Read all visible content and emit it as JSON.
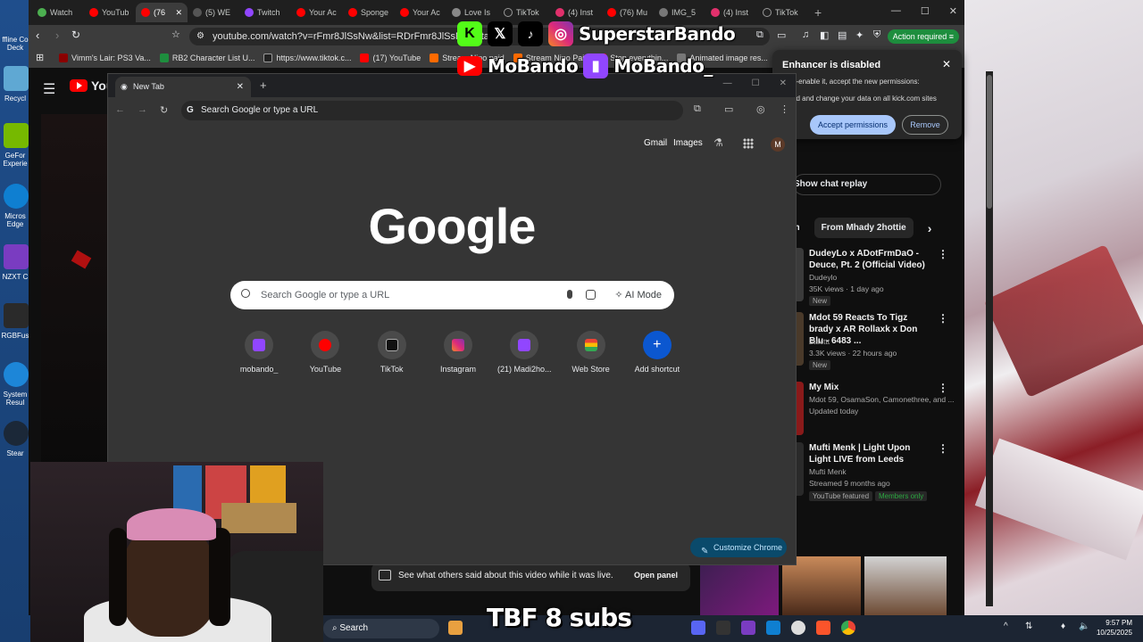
{
  "browser": {
    "tabs": [
      {
        "label": "Watch",
        "color": "#4caf50"
      },
      {
        "label": "YouTub",
        "color": "#ff0000"
      },
      {
        "label": "(76",
        "color": "#ff0000",
        "active": true
      },
      {
        "label": "(5) WE",
        "color": "#555555"
      },
      {
        "label": "Twitch",
        "color": "#9146ff"
      },
      {
        "label": "Your Ac",
        "color": "#ff0000"
      },
      {
        "label": "Sponge",
        "color": "#ff0000"
      },
      {
        "label": "Your Ac",
        "color": "#ff0000"
      },
      {
        "label": "Love Is",
        "color": "#888888"
      },
      {
        "label": "TikTok",
        "color": "#222222"
      },
      {
        "label": "(4) Inst",
        "color": "#e1306c"
      },
      {
        "label": "(76) Mu",
        "color": "#ff0000"
      },
      {
        "label": "IMG_5",
        "color": "#777777"
      },
      {
        "label": "(4) Inst",
        "color": "#e1306c"
      },
      {
        "label": "TikTok",
        "color": "#222222"
      }
    ],
    "url": "youtube.com/watch?v=rFmr8JlSsNw&list=RDrFmr8JlSsNw&start_",
    "action_required": "Action required",
    "bookmarks": [
      {
        "label": "Vimm's Lair: PS3 Va...",
        "color": "#8b0000"
      },
      {
        "label": "RB2 Character List U...",
        "color": "#1e8e3e"
      },
      {
        "label": "https://www.tiktok.c...",
        "color": "#222222"
      },
      {
        "label": "(17) YouTube",
        "color": "#ff0000"
      },
      {
        "label": "Stream Nino paid",
        "color": "#ff6a00"
      },
      {
        "label": "Stream Nino Paid",
        "color": "#ff6a00"
      },
      {
        "label": "Stop everythin...",
        "color": "#ff0000"
      },
      {
        "label": "Animated image res...",
        "color": "#777777"
      }
    ]
  },
  "youtube": {
    "logo": "You",
    "show_chat_replay": "Show chat replay",
    "chips": [
      "ch",
      "From Mhady 2hottie"
    ],
    "recs": [
      {
        "title": "DudeyLo x ADotFrmDaO - Deuce, Pt. 2 (Official Video)",
        "channel": "Dudeylo",
        "meta": "35K views · 1 day ago",
        "badge": "New"
      },
      {
        "title": "Mdot 59 Reacts To Tigz brady x AR Rollaxk x Don Blu - 6483 ...",
        "channel": "2tacttt",
        "meta": "3.3K views · 22 hours ago",
        "badge": "New"
      },
      {
        "title": "My Mix",
        "channel": "Mdot 59, OsamaSon, Camonethree, and ...",
        "meta": "Updated today",
        "badge": ""
      },
      {
        "title": "Mufti Menk | Light Upon Light LIVE from Leeds",
        "channel": "Mufti Menk",
        "meta": "Streamed 9 months ago",
        "badge": "YouTube featured"
      }
    ],
    "members_only": "Members only",
    "see_others": "See what others said about this video while it was live.",
    "open_panel": "Open panel"
  },
  "enhancer": {
    "title": "Enhancer is disabled",
    "line1": "e-enable it, accept the new permissions:",
    "line2": "ad and change your data on all kick.com sites",
    "accept": "Accept permissions",
    "remove": "Remove"
  },
  "newtab": {
    "tab_label": "New Tab",
    "omnibox": "Search Google or type a URL",
    "gmail": "Gmail",
    "images": "Images",
    "avatar": "M",
    "logo": "Google",
    "search_placeholder": "Search Google or type a URL",
    "ai_mode": "AI Mode",
    "shortcuts": [
      {
        "label": "mobando_",
        "color": "#9146ff"
      },
      {
        "label": "YouTube",
        "color": "#ff0000"
      },
      {
        "label": "TikTok",
        "color": "#111111"
      },
      {
        "label": "Instagram",
        "color": "#e1306c"
      },
      {
        "label": "(21) Madi2ho...",
        "color": "#9146ff"
      },
      {
        "label": "Web Store",
        "color": "#4285f4"
      },
      {
        "label": "Add shortcut",
        "color": "#0b57d0"
      }
    ],
    "customize": "Customize Chrome"
  },
  "overlay": {
    "handle1": "SuperstarBando",
    "handle2": "MoBando",
    "handle3": "MoBando_",
    "tbf": "TBF 8 subs"
  },
  "desktop": {
    "icons": [
      {
        "label": "ffline Co Deck",
        "color": "#3a6ea5"
      },
      {
        "label": "Recycl",
        "color": "#5fa8d3"
      },
      {
        "label": "GeFor Experie",
        "color": "#76b900"
      },
      {
        "label": "Micros Edge",
        "color": "#0f7fd1"
      },
      {
        "label": "NZXT C",
        "color": "#7a3cc1"
      },
      {
        "label": "RGBFus",
        "color": "#2a2a2a"
      },
      {
        "label": "System Resul",
        "color": "#1d86d8"
      },
      {
        "label": "Stear",
        "color": "#1b2838"
      }
    ]
  },
  "taskbar": {
    "search": "Search",
    "time": "9:57 PM",
    "date": "10/25/2025"
  }
}
